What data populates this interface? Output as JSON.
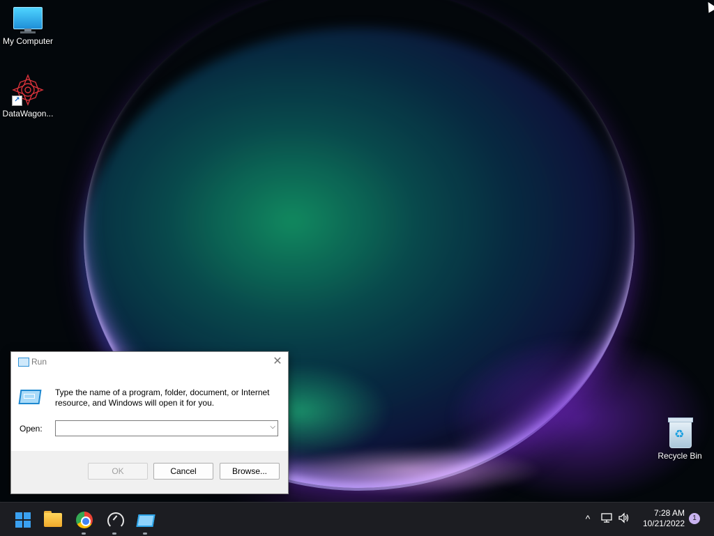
{
  "desktop": {
    "icons": [
      {
        "label": "My Computer",
        "icon": "monitor-icon"
      },
      {
        "label": "DataWagon...",
        "icon": "datawagon-icon"
      },
      {
        "label": "Recycle Bin",
        "icon": "recycle-bin-icon"
      }
    ]
  },
  "run_dialog": {
    "title": "Run",
    "close_symbol": "✕",
    "description": "Type the name of a program, folder, document, or Internet resource, and Windows will open it for you.",
    "open_label": "Open:",
    "open_value": "",
    "buttons": {
      "ok": "OK",
      "cancel": "Cancel",
      "browse": "Browse..."
    }
  },
  "taskbar": {
    "apps": [
      "start-icon",
      "file-explorer-icon",
      "chrome-icon",
      "speedometer-icon",
      "run-icon"
    ],
    "tray": {
      "chevron": "^",
      "time": "7:28 AM",
      "date": "10/21/2022",
      "notification_count": "1"
    }
  },
  "colors": {
    "accent": "#3aa0f0",
    "taskbar_bg": "#1c1d22",
    "dialog_bg": "#f0f0f0"
  }
}
